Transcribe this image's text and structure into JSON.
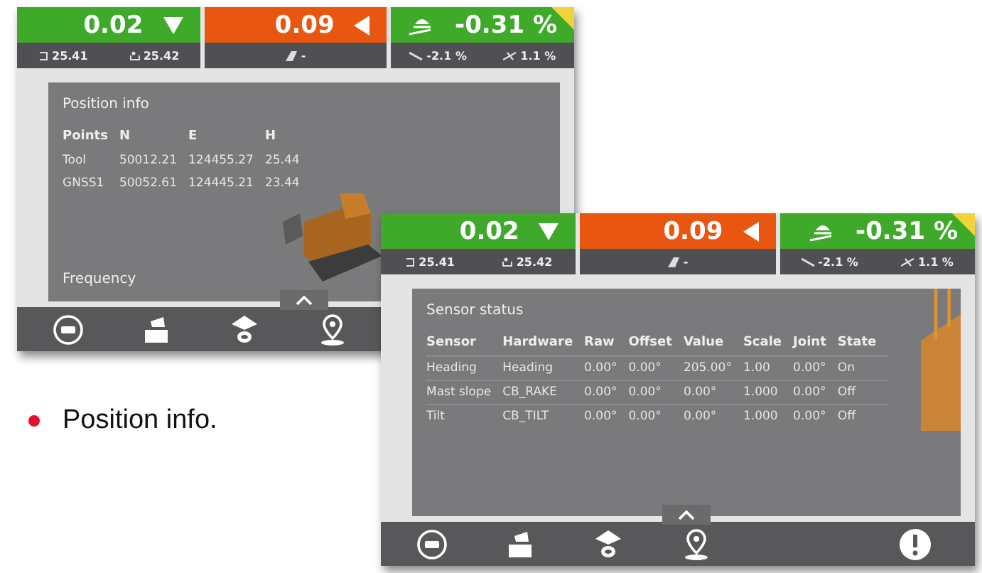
{
  "screens": [
    {
      "tiles": [
        {
          "value": "0.02",
          "warning": false,
          "kind": "down",
          "readings": [
            "25.41",
            "25.42"
          ]
        },
        {
          "value": "0.09",
          "warning": true,
          "kind": "left",
          "readings": [
            "-"
          ]
        },
        {
          "value": "-0.31 %",
          "warning": false,
          "kind": "plain",
          "flagged": true,
          "readings": [
            "-2.1 %",
            "1.1 %"
          ]
        }
      ],
      "panel": {
        "title": "Position info",
        "columns": [
          "Points",
          "N",
          "E",
          "H"
        ],
        "rows": [
          [
            "Tool",
            "50012.21",
            "124455.27",
            "25.44"
          ],
          [
            "GNSS1",
            "50052.61",
            "124445.21",
            "23.44"
          ]
        ],
        "footer": "Frequency"
      }
    },
    {
      "tiles": [
        {
          "value": "0.02",
          "warning": false,
          "kind": "down",
          "readings": [
            "25.41",
            "25.42"
          ]
        },
        {
          "value": "0.09",
          "warning": true,
          "kind": "left",
          "readings": [
            "-"
          ]
        },
        {
          "value": "-0.31 %",
          "warning": false,
          "kind": "plain",
          "flagged": true,
          "readings": [
            "-2.1 %",
            "1.1 %"
          ]
        }
      ],
      "panel": {
        "title": "Sensor status",
        "columns": [
          "Sensor",
          "Hardware",
          "Raw",
          "Offset",
          "Value",
          "Scale",
          "Joint",
          "State"
        ],
        "rows": [
          [
            "Heading",
            "Heading",
            "0.00°",
            "0.00°",
            "205.00°",
            "1.00",
            "0.00°",
            "On"
          ],
          [
            "Mast slope",
            "CB_RAKE",
            "0.00°",
            "0.00°",
            "0.00°",
            "1.000",
            "0.00°",
            "Off"
          ],
          [
            "Tilt",
            "CB_TILT",
            "0.00°",
            "0.00°",
            "0.00°",
            "1.000",
            "0.00°",
            "Off"
          ]
        ]
      },
      "alert": true
    }
  ],
  "bullet": "Position info."
}
